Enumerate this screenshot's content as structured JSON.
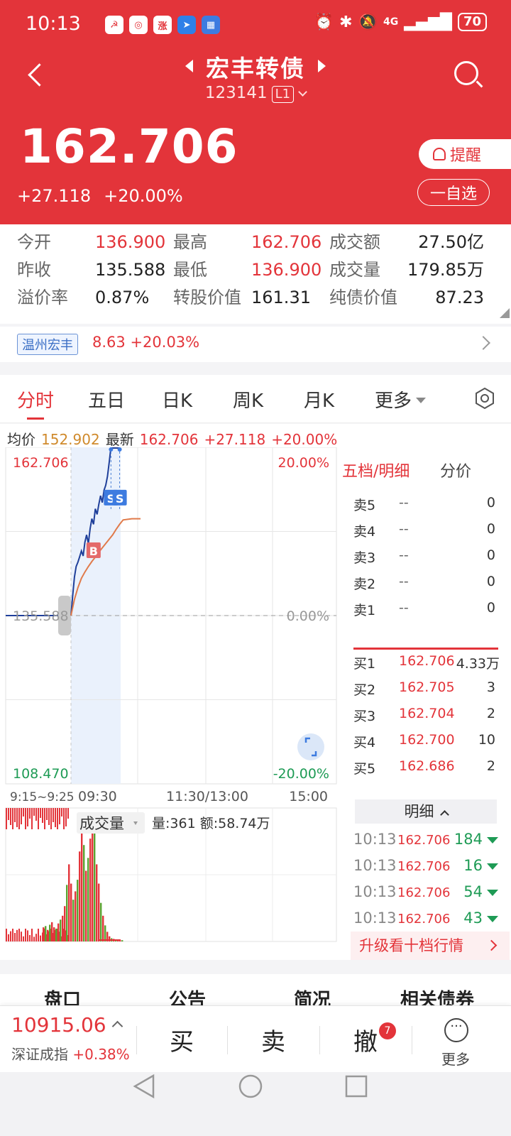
{
  "status_bar": {
    "time": "10:13",
    "battery": "70",
    "network": "4G",
    "app_icons": [
      "app-icon-1",
      "app-icon-2",
      "app-icon-3",
      "app-icon-4",
      "app-icon-5"
    ],
    "system_icons": [
      "alarm-icon",
      "bluetooth-icon",
      "mute-icon",
      "signal-icon",
      "battery-icon"
    ]
  },
  "header": {
    "name": "宏丰转债",
    "code": "123141",
    "level": "L1",
    "price": "162.706",
    "change": "+27.118",
    "change_pct": "+20.00%",
    "remind_label": "提醒",
    "watch_label": "一自选",
    "accent_color": "#e3343a"
  },
  "stats": [
    {
      "label": "今开",
      "value": "136.900",
      "color": "red"
    },
    {
      "label": "最高",
      "value": "162.706",
      "color": "red"
    },
    {
      "label": "成交额",
      "value": "27.50亿",
      "color": "dark"
    },
    {
      "label": "昨收",
      "value": "135.588",
      "color": "dark"
    },
    {
      "label": "最低",
      "value": "136.900",
      "color": "red"
    },
    {
      "label": "成交量",
      "value": "179.85万",
      "color": "dark"
    },
    {
      "label": "溢价率",
      "value": "0.87%",
      "color": "dark"
    },
    {
      "label": "转股价值",
      "value": "161.31",
      "color": "dark"
    },
    {
      "label": "纯债价值",
      "value": "87.23",
      "color": "dark"
    }
  ],
  "stock": {
    "name": "温州宏丰",
    "price": "8.63",
    "pct": "+20.03%"
  },
  "tabs": [
    "分时",
    "五日",
    "日K",
    "周K",
    "月K",
    "更多"
  ],
  "avg_row": {
    "avg_label": "均价",
    "avg_value": "152.902",
    "latest_label": "最新",
    "latest_value": "162.706",
    "change": "+27.118",
    "pct": "+20.00%"
  },
  "chart_data": {
    "type": "line",
    "title": "",
    "price_axis": {
      "top": "162.706",
      "mid": "135.588",
      "bottom": "108.470"
    },
    "pct_axis": {
      "top": "20.00%",
      "mid": "0.00%",
      "bottom": "-20.00%"
    },
    "time_labels": [
      "9:15~9:25",
      "09:30",
      "11:30/13:00",
      "15:00"
    ],
    "ylim": [
      108.47,
      162.706
    ],
    "series": [
      {
        "color": "#1f3f9a",
        "x": [
          0,
          1,
          2,
          3,
          4,
          5,
          6,
          7,
          8,
          9,
          10,
          11,
          12,
          13,
          14,
          15,
          16,
          17,
          18,
          19,
          20,
          21,
          22,
          23,
          24,
          25,
          26,
          27,
          28
        ],
        "values": [
          135.59,
          138.9,
          141.8,
          143.5,
          144.2,
          145.1,
          146.0,
          145.2,
          147.4,
          148.6,
          147.2,
          149.6,
          151.2,
          150.3,
          152.8,
          151.9,
          153.5,
          154.9,
          153.8,
          155.8,
          156.6,
          158.0,
          160.3,
          162.706,
          162.706,
          162.706,
          162.706,
          162.706,
          162.706
        ]
      },
      {
        "color": "#e07a4a",
        "x": [
          0,
          2,
          4,
          6,
          8,
          10,
          12,
          14,
          16,
          18,
          20,
          22,
          24,
          26,
          28,
          30,
          35,
          40
        ],
        "values": [
          135.59,
          138.2,
          140.1,
          141.6,
          142.6,
          143.5,
          144.3,
          145.0,
          145.8,
          146.5,
          147.2,
          147.9,
          148.6,
          149.5,
          150.3,
          151.0,
          151.2,
          151.2
        ]
      }
    ],
    "trade_marks": [
      {
        "label": "B",
        "x": 18,
        "price": 145.2
      },
      {
        "label": "S",
        "x": 24,
        "price": 154.6
      },
      {
        "label": "S",
        "x": 34,
        "price": 154.6
      }
    ],
    "volume_label": "成交量",
    "volume_info": "量:361 额:58.74万",
    "volume_values": [
      22,
      24,
      18,
      26,
      30,
      22,
      20,
      28,
      34,
      40,
      55,
      88,
      120,
      90,
      65,
      78,
      96,
      140,
      180,
      150,
      110,
      130,
      160,
      190,
      170,
      120,
      90,
      60,
      40,
      25,
      15,
      8,
      5,
      4,
      3,
      3,
      2,
      2
    ],
    "volume_colors": [
      "r",
      "g",
      "r",
      "g",
      "r",
      "r",
      "g",
      "r",
      "g",
      "r",
      "r",
      "g",
      "r",
      "r",
      "g",
      "r",
      "g",
      "r",
      "r",
      "g",
      "r",
      "g",
      "r",
      "r",
      "g",
      "r",
      "r",
      "g",
      "r",
      "g",
      "r",
      "r",
      "g",
      "r",
      "g",
      "r",
      "r",
      "g"
    ],
    "auction_vol_color": "#e3343a"
  },
  "order_book": {
    "title": "五档/明细",
    "split_label": "分价",
    "sell": [
      {
        "label": "卖5",
        "price": "--",
        "vol": "0"
      },
      {
        "label": "卖4",
        "price": "--",
        "vol": "0"
      },
      {
        "label": "卖3",
        "price": "--",
        "vol": "0"
      },
      {
        "label": "卖2",
        "price": "--",
        "vol": "0"
      },
      {
        "label": "卖1",
        "price": "--",
        "vol": "0"
      }
    ],
    "buy": [
      {
        "label": "买1",
        "price": "162.706",
        "vol": "4.33万"
      },
      {
        "label": "买2",
        "price": "162.705",
        "vol": "3"
      },
      {
        "label": "买3",
        "price": "162.704",
        "vol": "2"
      },
      {
        "label": "买4",
        "price": "162.700",
        "vol": "10"
      },
      {
        "label": "买5",
        "price": "162.686",
        "vol": "2"
      }
    ],
    "detail_label": "明细",
    "details": [
      {
        "time": "10:13",
        "price": "162.706",
        "vol": "184"
      },
      {
        "time": "10:13",
        "price": "162.706",
        "vol": "16"
      },
      {
        "time": "10:13",
        "price": "162.706",
        "vol": "54"
      },
      {
        "time": "10:13",
        "price": "162.706",
        "vol": "43"
      }
    ],
    "upgrade_label": "升级看十档行情"
  },
  "bottom_tabs": [
    "盘口",
    "公告",
    "简况",
    "相关债券"
  ],
  "bottom_bar": {
    "index_value": "10915.06",
    "index_name": "深证成指",
    "index_pct": "+0.38%",
    "buy": "买",
    "sell": "卖",
    "cancel": "撤",
    "cancel_badge": "7",
    "more": "更多"
  }
}
